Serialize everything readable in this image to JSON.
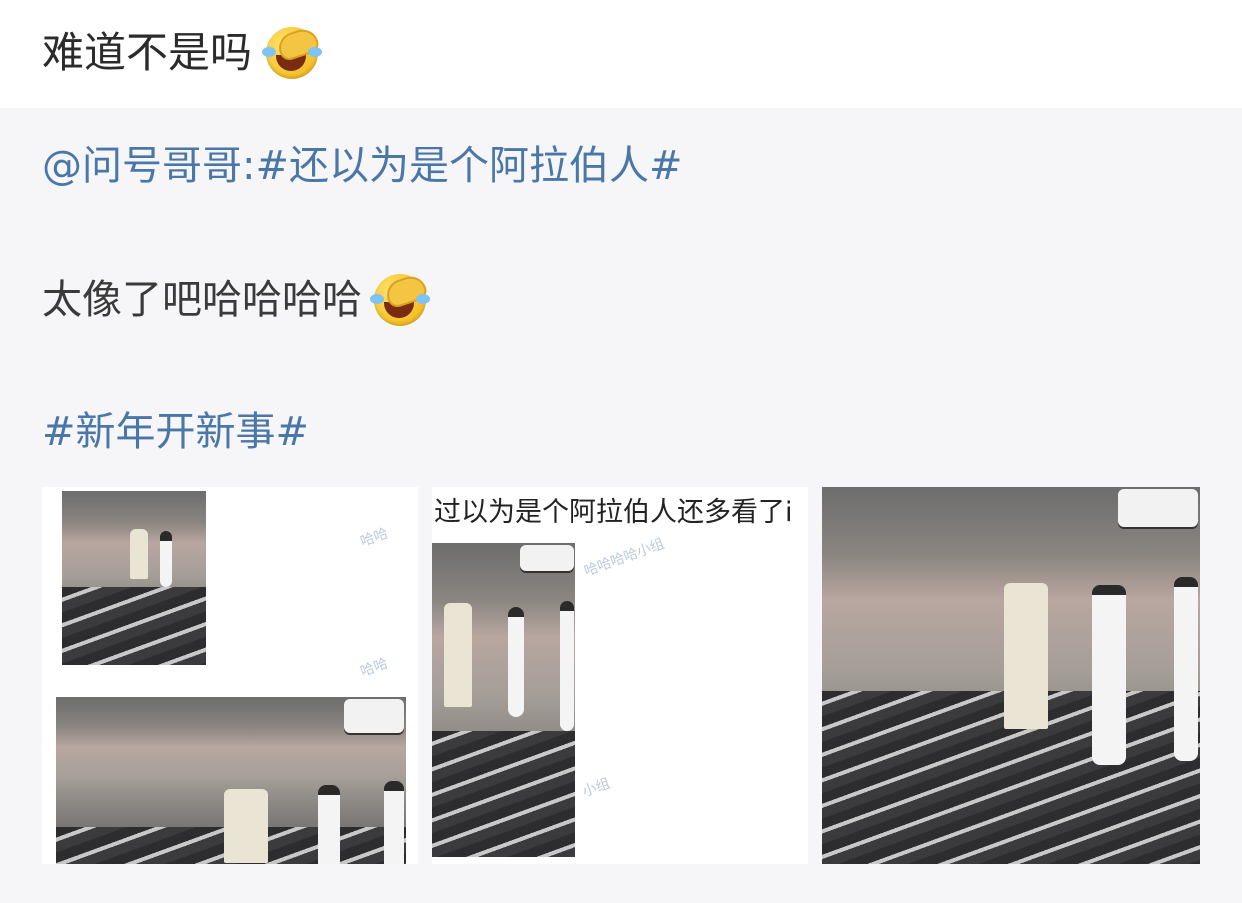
{
  "post": {
    "comment_text": "难道不是吗",
    "comment_emoji": "laughing-tears-emoji"
  },
  "repost": {
    "author_mention": "@问号哥哥:",
    "hashtag_1": "#还以为是个阿拉伯人#",
    "body_text": "太像了吧哈哈哈哈",
    "body_emoji": "laughing-tears-emoji",
    "hashtag_2": "#新年开新事#"
  },
  "images": {
    "middle_caption": "过以为是个阿拉伯人还多看了i"
  },
  "colors": {
    "link": "#4a77a8",
    "panel_bg": "#f6f6f8"
  }
}
